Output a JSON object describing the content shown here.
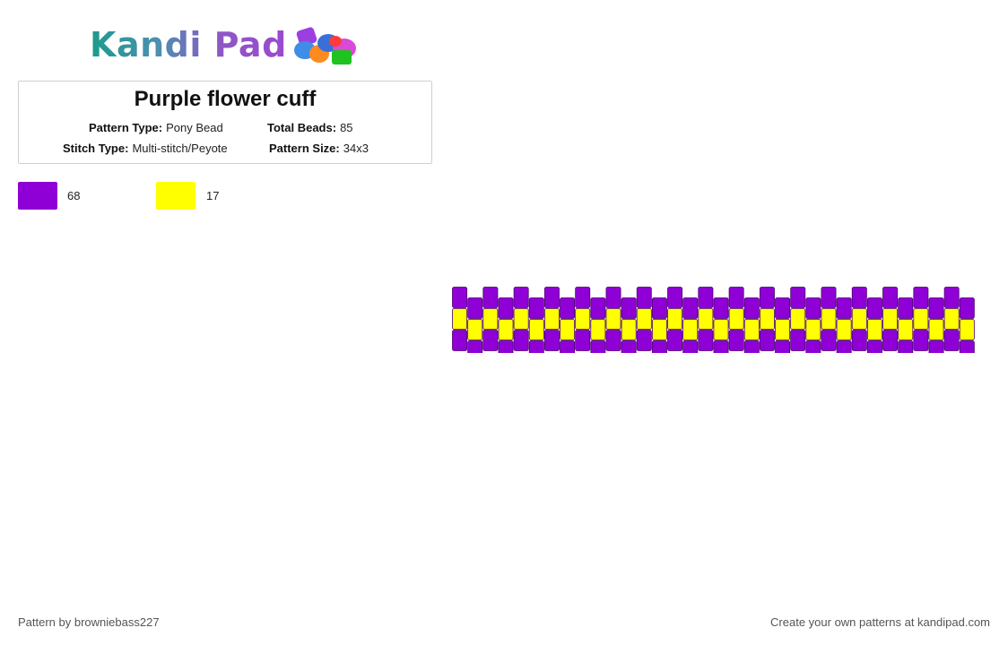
{
  "logo": {
    "text": "Kandi Pad"
  },
  "pattern": {
    "title": "Purple flower cuff",
    "type_label": "Pattern Type:",
    "type_value": "Pony Bead",
    "total_label": "Total Beads:",
    "total_value": "85",
    "stitch_label": "Stitch Type:",
    "stitch_value": "Multi-stitch/Peyote",
    "size_label": "Pattern Size:",
    "size_value": "34x3"
  },
  "colors": [
    {
      "hex": "#8f00d6",
      "count": "68"
    },
    {
      "hex": "#ffff00",
      "count": "17"
    }
  ],
  "grid": {
    "columns": 34,
    "rows": 3,
    "row_colors": [
      "#8f00d6",
      "#ffff00",
      "#8f00d6"
    ],
    "bead_border": "#4b006f"
  },
  "footer": {
    "author": "Pattern by browniebass227",
    "promo": "Create your own patterns at kandipad.com"
  }
}
